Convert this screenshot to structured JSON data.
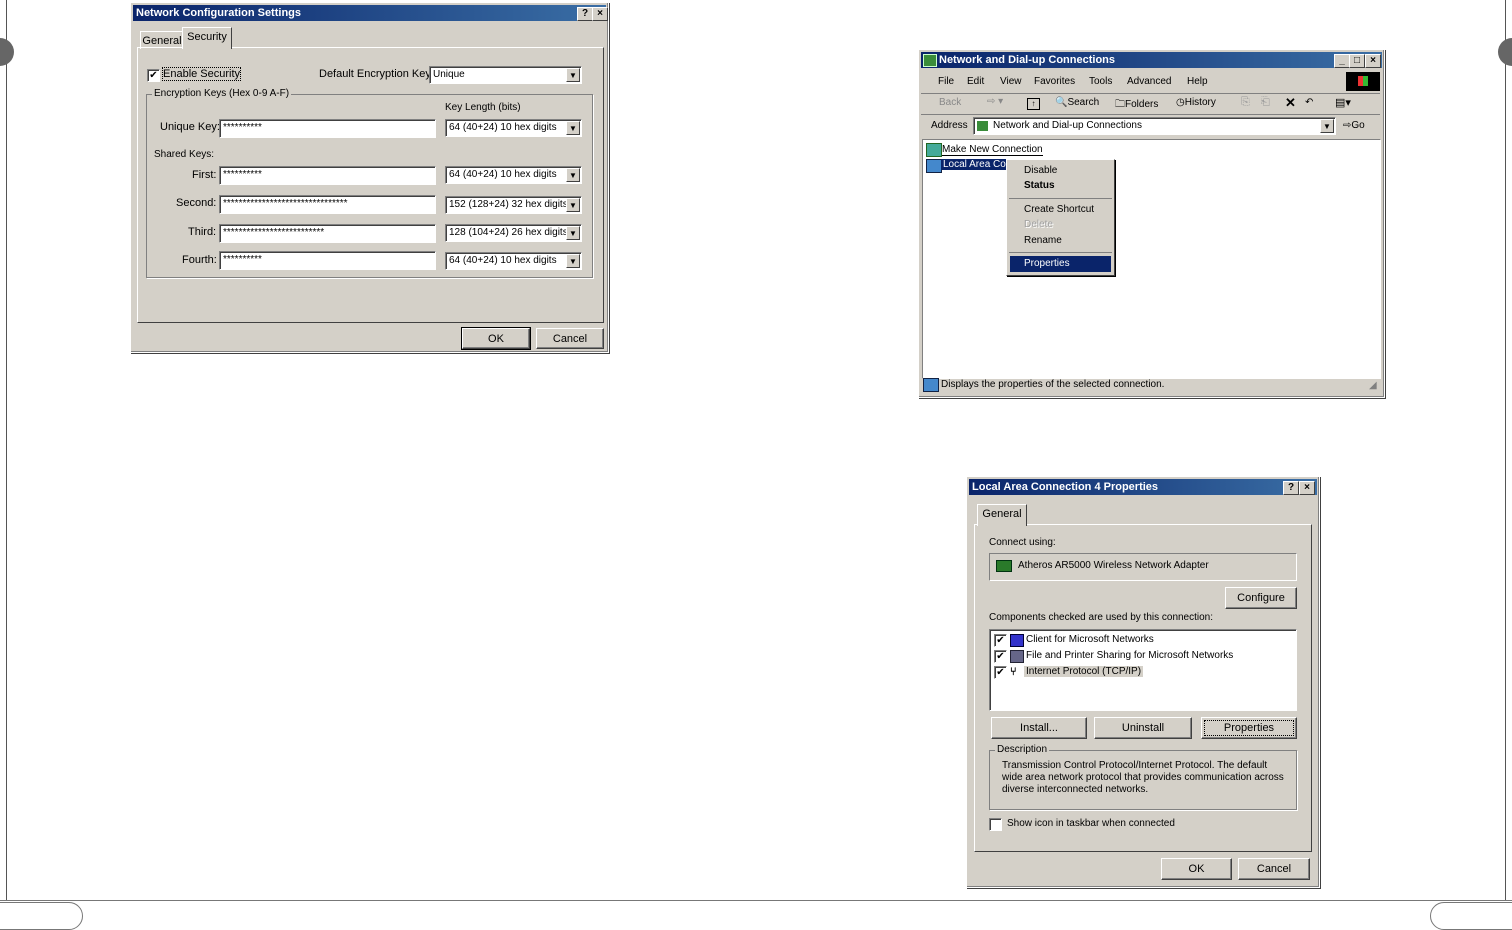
{
  "colors": {
    "titlebar": "#0a246a",
    "face": "#d4d0c8",
    "highlight": "#0a246a",
    "selection_text": "#ffffff"
  },
  "net_config": {
    "title": "Network Configuration Settings",
    "help_btn": "?",
    "close_btn": "×",
    "tabs": [
      "General",
      "Security"
    ],
    "active_tab": "Security",
    "enable_security_label": "Enable Security",
    "enable_security_checked": true,
    "default_key_label": "Default Encryption Key:",
    "default_key_value": "Unique",
    "encryption_group_label": "Encryption Keys (Hex 0-9 A-F)",
    "key_length_header": "Key Length (bits)",
    "unique_key_label": "Unique Key:",
    "unique_key_value": "**********",
    "unique_key_length": "64 (40+24) 10 hex digits",
    "shared_keys_label": "Shared Keys:",
    "shared": [
      {
        "label": "First:",
        "value": "**********",
        "length": "64 (40+24) 10 hex digits"
      },
      {
        "label": "Second:",
        "value": "********************************",
        "length": "152 (128+24) 32 hex digits"
      },
      {
        "label": "Third:",
        "value": "**************************",
        "length": "128 (104+24) 26 hex digits"
      },
      {
        "label": "Fourth:",
        "value": "**********",
        "length": "64 (40+24) 10 hex digits"
      }
    ],
    "ok": "OK",
    "cancel": "Cancel"
  },
  "dialup": {
    "title": "Network and Dial-up Connections",
    "menu": [
      "File",
      "Edit",
      "View",
      "Favorites",
      "Tools",
      "Advanced",
      "Help"
    ],
    "toolbar": {
      "back": "Back",
      "search": "Search",
      "folders": "Folders",
      "history": "History"
    },
    "address_label": "Address",
    "address_value": "Network and Dial-up Connections",
    "go": "Go",
    "items": [
      "Make New Connection",
      "Local Area Con"
    ],
    "context_menu": [
      "Disable",
      "Status",
      "Create Shortcut",
      "Delete",
      "Rename",
      "Properties"
    ],
    "context_selected": "Properties",
    "status_text": "Displays the properties of the selected connection."
  },
  "lan_props": {
    "title": "Local Area Connection 4 Properties",
    "help_btn": "?",
    "close_btn": "×",
    "tab": "General",
    "connect_using_label": "Connect using:",
    "adapter": "Atheros AR5000 Wireless Network Adapter",
    "configure": "Configure",
    "components_label": "Components checked are used by this connection:",
    "components": [
      {
        "name": "Client for Microsoft Networks",
        "checked": true
      },
      {
        "name": "File and Printer Sharing for Microsoft Networks",
        "checked": true
      },
      {
        "name": "Internet Protocol (TCP/IP)",
        "checked": true
      }
    ],
    "install": "Install...",
    "uninstall": "Uninstall",
    "properties": "Properties",
    "description_label": "Description",
    "description": "Transmission Control Protocol/Internet Protocol. The default wide area network protocol that provides communication across diverse interconnected networks.",
    "show_icon_label": "Show icon in taskbar when connected",
    "ok": "OK",
    "cancel": "Cancel"
  }
}
